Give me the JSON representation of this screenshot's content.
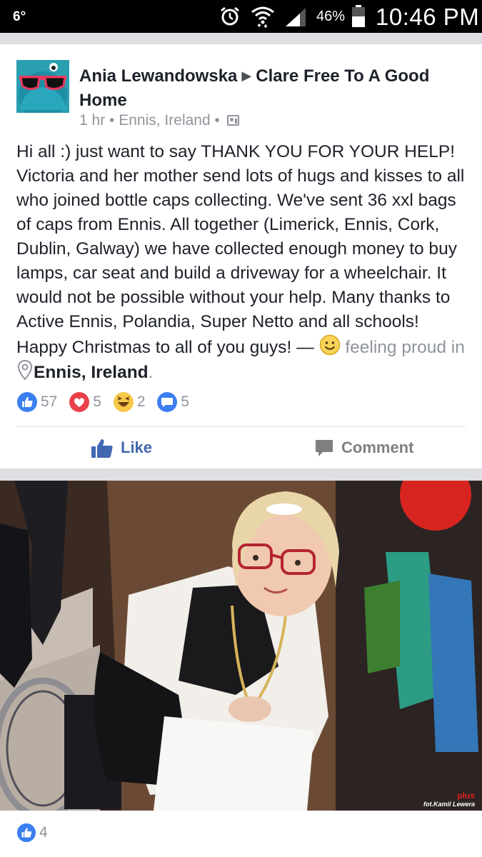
{
  "status_bar": {
    "temperature": "6°",
    "battery_percent": "46%",
    "time": "10:46 PM",
    "icons": [
      "alarm-icon",
      "wifi-icon",
      "signal-icon",
      "battery-icon"
    ]
  },
  "post": {
    "author": "Ania Lewandowska",
    "group": "Clare Free To A Good Home",
    "time": "1 hr",
    "location": "Ennis, Ireland",
    "separator": "•",
    "body": "Hi all :) just want to say THANK YOU FOR YOUR HELP! Victoria and her mother send lots of hugs and kisses to all who joined bottle caps collecting. We've sent 36 xxl bags of caps from Ennis. All together (Limerick, Ennis, Cork, Dublin, Galway) we have collected enough money to buy lamps, car seat and build a driveway for a wheelchair. It would not be possible without your help. Many thanks to Active Ennis, Polandia, Super Netto and all schools! Happy Christmas to all of you guys!",
    "dash": " — ",
    "feeling": "feeling proud in",
    "place": "Ennis, Ireland",
    "place_suffix": "."
  },
  "reactions": {
    "like": "57",
    "love": "5",
    "haha": "2",
    "comments": "5"
  },
  "actions": {
    "like_label": "Like",
    "comment_label": "Comment"
  },
  "photo": {
    "watermark_brand": "plus",
    "watermark_credit": "fot.Kamil Lewera",
    "likes": "4"
  },
  "colors": {
    "facebook_blue": "#4267b2",
    "like_blue": "#3b7ff0",
    "love_red": "#e9414b",
    "haha_yellow": "#f7c94a",
    "meta_gray": "#90949c"
  }
}
